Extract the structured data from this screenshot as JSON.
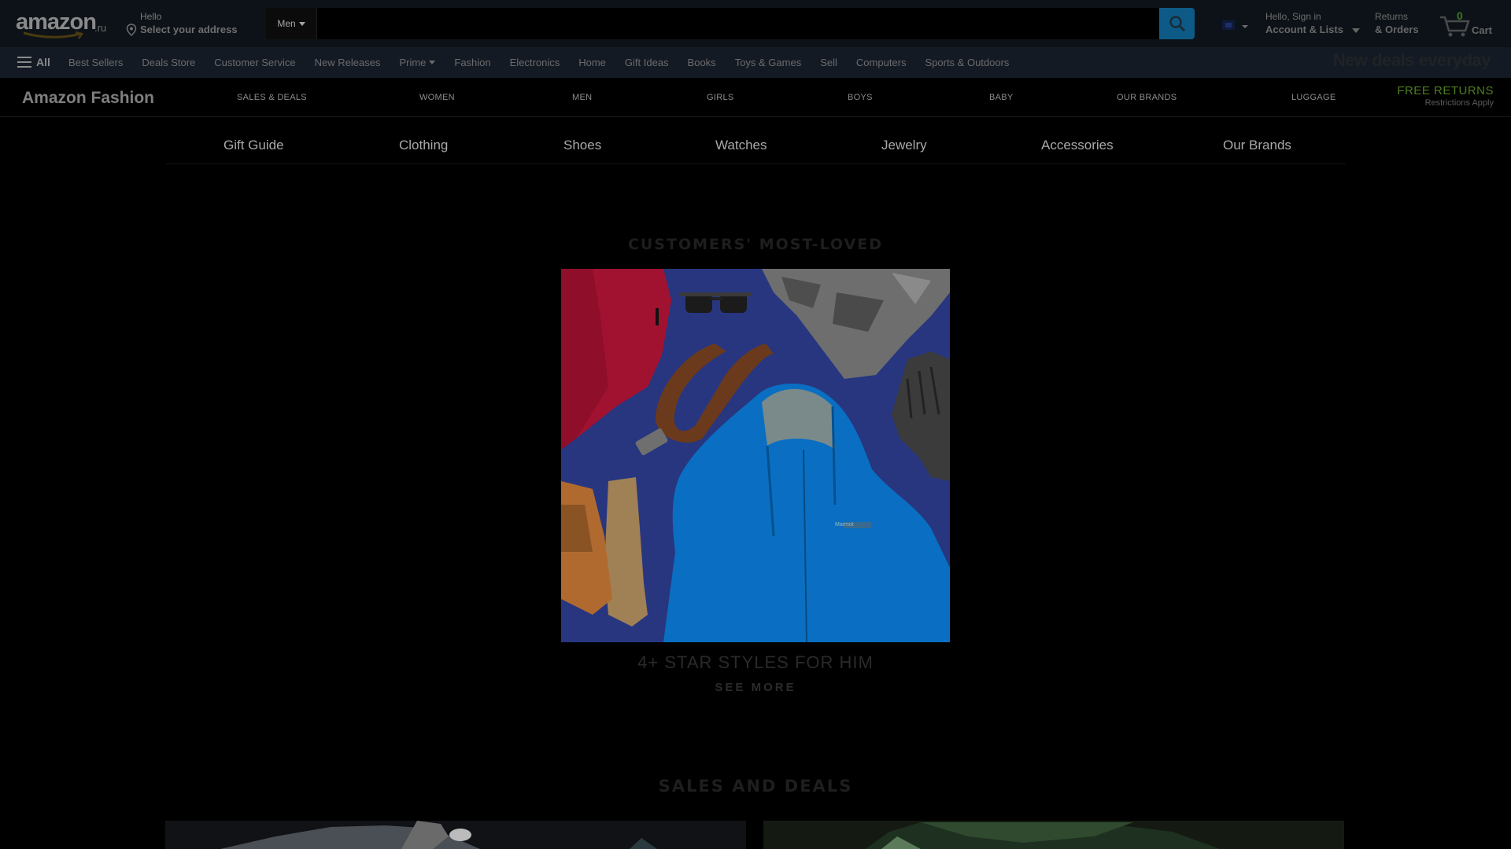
{
  "header": {
    "logo_text": "amazon",
    "logo_tld": ".ru",
    "deliver_line1": "Hello",
    "deliver_line2": "Select your address",
    "search_category": "Men",
    "search_placeholder": "",
    "account_line1": "Hello, Sign in",
    "account_line2": "Account & Lists",
    "returns_line1": "Returns",
    "returns_line2": "& Orders",
    "cart_count": "0",
    "cart_label": "Cart"
  },
  "nav": {
    "all_label": "All",
    "items": [
      "Best Sellers",
      "Deals Store",
      "Customer Service",
      "New Releases",
      "Prime",
      "Fashion",
      "Electronics",
      "Home",
      "Gift Ideas",
      "Books",
      "Toys & Games",
      "Sell",
      "Computers",
      "Sports & Outdoors"
    ],
    "promo": "New deals everyday"
  },
  "fashion": {
    "brand": "Amazon Fashion",
    "items": [
      "SALES & DEALS",
      "WOMEN",
      "MEN",
      "GIRLS",
      "BOYS",
      "BABY",
      "OUR BRANDS",
      "LUGGAGE"
    ],
    "free_returns": "FREE RETURNS",
    "restrictions": "Restrictions Apply"
  },
  "categories": [
    "Gift Guide",
    "Clothing",
    "Shoes",
    "Watches",
    "Jewelry",
    "Accessories",
    "Our Brands"
  ],
  "most_loved": {
    "title": "CUSTOMERS' MOST-LOVED",
    "caption": "4+ STAR STYLES FOR HIM",
    "see_more": "SEE MORE",
    "jacket_brand": "Marmot"
  },
  "sales": {
    "title": "SALES AND DEALS"
  },
  "colors": {
    "search_button": "#0d5a86",
    "cart_count": "#3c7a1e",
    "free_returns": "#4f7d20"
  }
}
